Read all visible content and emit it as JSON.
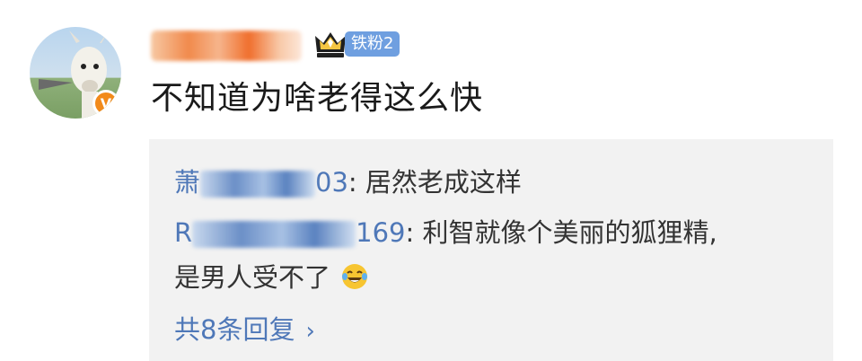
{
  "post": {
    "fan_badge": "铁粉2",
    "text": "不知道为啥老得这么快",
    "verified_icon": "verified-v-icon",
    "crown_icon": "crown-icon"
  },
  "replies": [
    {
      "name_visible_prefix": "萧",
      "name_visible_suffix": "03",
      "separator": ":",
      "text": "居然老成这样"
    },
    {
      "name_visible_prefix": "R",
      "name_visible_suffix": "169",
      "separator": ":",
      "text_line1": "利智就像个美丽的狐狸精,",
      "text_line2": "是男人受不了",
      "emoji": "laughing-tears-emoji"
    }
  ],
  "more_replies_label": "共8条回复",
  "colors": {
    "link": "#4f78b8",
    "badge": "#6f9fe0",
    "verified": "#f28a1a",
    "reply_bg": "#f2f2f2"
  }
}
